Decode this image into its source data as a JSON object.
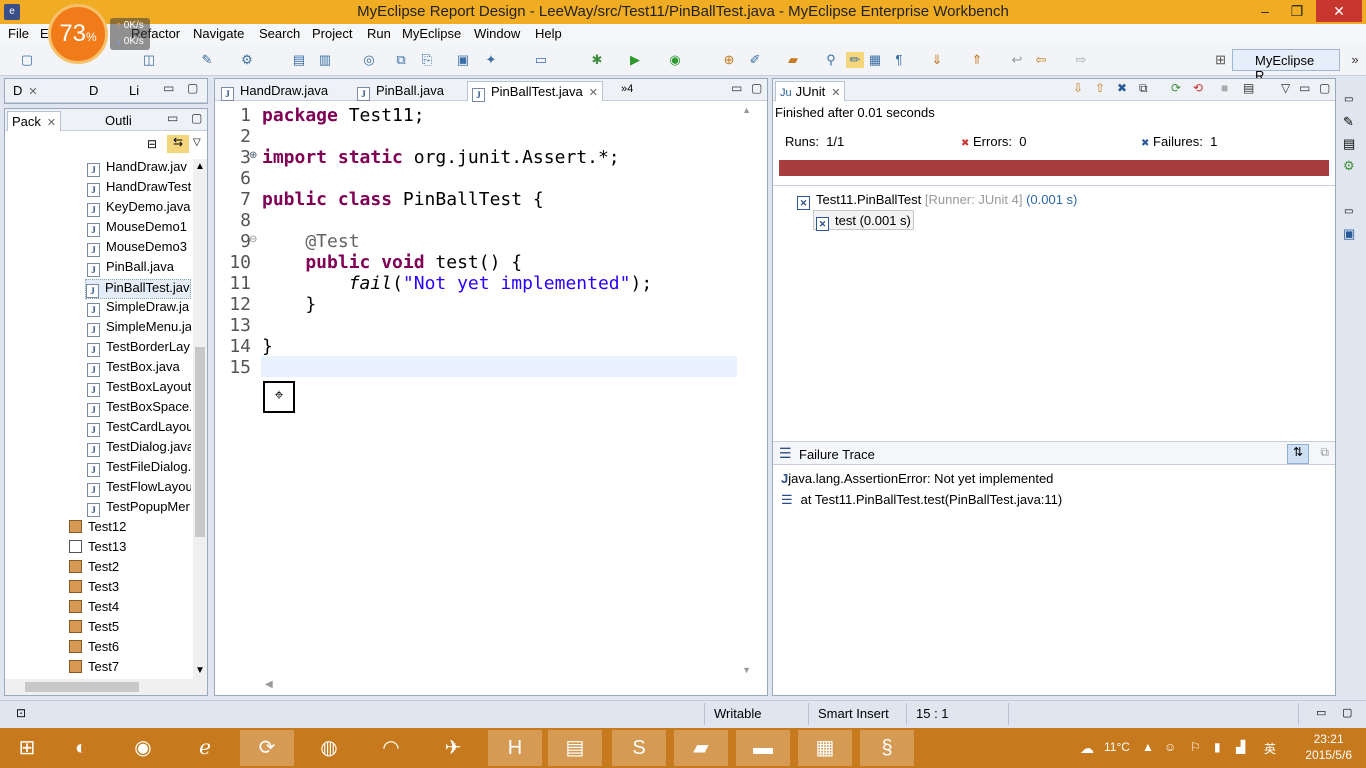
{
  "window": {
    "title": "MyEclipse Report Design - LeeWay/src/Test11/PinBallTest.java - MyEclipse Enterprise Workbench",
    "minimize": "–",
    "maximize": "❐",
    "close": "✕"
  },
  "overlay": {
    "percent": "73",
    "percent_sign": "%",
    "up": "0K/s",
    "down": "0K/s"
  },
  "menu": [
    "File",
    "Edit",
    "Refactor",
    "Navigate",
    "Search",
    "Project",
    "Run",
    "MyEclipse",
    "Window",
    "Help"
  ],
  "toolbar": {
    "perspective_label": "MyEclipse R..."
  },
  "left_top_tabs": [
    "D",
    "D",
    "Li"
  ],
  "explorer": {
    "tabs": [
      "Pack",
      "Outli"
    ],
    "files": [
      "HandDraw.java",
      "HandDrawTest",
      "KeyDemo.java",
      "MouseDemo1",
      "MouseDemo3",
      "PinBall.java",
      "PinBallTest.java",
      "SimpleDraw.ja",
      "SimpleMenu.ja",
      "TestBorderLay",
      "TestBox.java",
      "TestBoxLayout",
      "TestBoxSpace.",
      "TestCardLayou",
      "TestDialog.java",
      "TestFileDialog.",
      "TestFlowLayou",
      "TestPopupMer"
    ],
    "packages": [
      "Test12",
      "Test13",
      "Test2",
      "Test3",
      "Test4",
      "Test5",
      "Test6",
      "Test7"
    ]
  },
  "editor": {
    "tabs": [
      "HandDraw.java",
      "PinBall.java",
      "PinBallTest.java"
    ],
    "overflow": "»4",
    "line_numbers": [
      "1",
      "2",
      "3",
      "6",
      "7",
      "8",
      "9",
      "10",
      "11",
      "12",
      "13",
      "14",
      "15"
    ],
    "code": {
      "l1_kw": "package",
      "l1_rest": " Test11;",
      "l3_kw": "import static",
      "l3_rest": " org.junit.Assert.*;",
      "l7_kw": "public class",
      "l7_rest": " PinBallTest {",
      "l9": "    @Test",
      "l10_kw": "    public void",
      "l10_rest": " test() {",
      "l11_pre": "        ",
      "l11_it": "fail",
      "l11_open": "(",
      "l11_str": "\"Not yet implemented\"",
      "l11_close": ");",
      "l12": "    }",
      "l14": "}"
    },
    "cursor_glyph": "⌖"
  },
  "junit": {
    "tab": "JUnit",
    "finished": "Finished after 0.01 seconds",
    "runs_label": "Runs:",
    "runs_value": "1/1",
    "errors_label": "Errors:",
    "errors_value": "0",
    "failures_label": "Failures:",
    "failures_value": "1",
    "bar_color": "#a83d3d",
    "suite_name": "Test11.PinBallTest",
    "suite_runner": "[Runner: JUnit 4]",
    "suite_time": "(0.001 s)",
    "test_name": "test (0.001 s)",
    "trace_title": "Failure Trace",
    "trace_lines": [
      "java.lang.AssertionError: Not yet implemented",
      "at Test11.PinBallTest.test(PinBallTest.java:11)"
    ]
  },
  "status": {
    "writable": "Writable",
    "insert_mode": "Smart Insert",
    "position": "15 : 1"
  },
  "taskbar": {
    "apps": [
      "windows-start",
      "firefox",
      "chrome",
      "internet-explorer",
      "360-browser",
      "browser-2",
      "wifi-tool",
      "bird-app",
      "h-app",
      "file-explorer",
      "s-app",
      "notebook-app",
      "cmd",
      "media-app",
      "myeclipse"
    ],
    "weather": "11°C",
    "ime": "英",
    "time": "23:21",
    "date": "2015/5/6"
  }
}
